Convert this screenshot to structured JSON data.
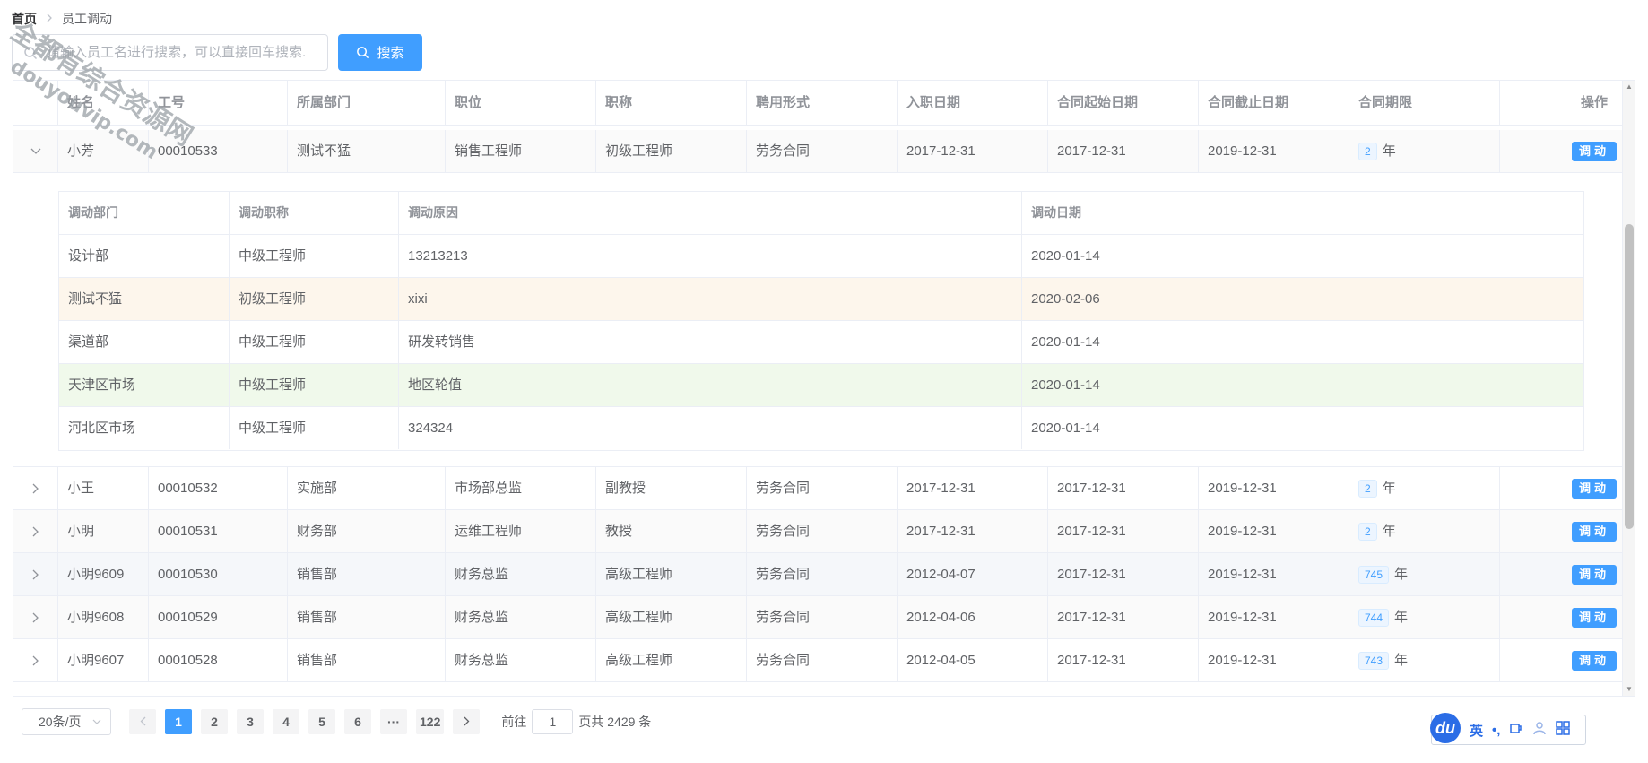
{
  "breadcrumb": {
    "home": "首页",
    "separator": ">",
    "current": "员工调动"
  },
  "search": {
    "placeholder": "请输入员工名进行搜索，可以直接回车搜索...",
    "button_label": "搜索"
  },
  "table": {
    "columns": [
      "",
      "姓名",
      "工号",
      "所属部门",
      "职位",
      "职称",
      "聘用形式",
      "入职日期",
      "合同起始日期",
      "合同截止日期",
      "合同期限",
      "操作"
    ],
    "action_label": "调动",
    "term_unit": "年",
    "rows": [
      {
        "name": "小芳",
        "id": "00010533",
        "dept": "测试不猛",
        "position": "销售工程师",
        "title": "初级工程师",
        "hire": "劳务合同",
        "entry": "2017-12-31",
        "start": "2017-12-31",
        "end": "2019-12-31",
        "term": "2",
        "expanded": true
      },
      {
        "name": "小王",
        "id": "00010532",
        "dept": "实施部",
        "position": "市场部总监",
        "title": "副教授",
        "hire": "劳务合同",
        "entry": "2017-12-31",
        "start": "2017-12-31",
        "end": "2019-12-31",
        "term": "2"
      },
      {
        "name": "小明",
        "id": "00010531",
        "dept": "财务部",
        "position": "运维工程师",
        "title": "教授",
        "hire": "劳务合同",
        "entry": "2017-12-31",
        "start": "2017-12-31",
        "end": "2019-12-31",
        "term": "2"
      },
      {
        "name": "小明9609",
        "id": "00010530",
        "dept": "销售部",
        "position": "财务总监",
        "title": "高级工程师",
        "hire": "劳务合同",
        "entry": "2012-04-07",
        "start": "2017-12-31",
        "end": "2019-12-31",
        "term": "745"
      },
      {
        "name": "小明9608",
        "id": "00010529",
        "dept": "销售部",
        "position": "财务总监",
        "title": "高级工程师",
        "hire": "劳务合同",
        "entry": "2012-04-06",
        "start": "2017-12-31",
        "end": "2019-12-31",
        "term": "744"
      },
      {
        "name": "小明9607",
        "id": "00010528",
        "dept": "销售部",
        "position": "财务总监",
        "title": "高级工程师",
        "hire": "劳务合同",
        "entry": "2012-04-05",
        "start": "2017-12-31",
        "end": "2019-12-31",
        "term": "743"
      }
    ]
  },
  "transfer": {
    "columns": [
      "调动部门",
      "调动职称",
      "调动原因",
      "调动日期"
    ],
    "rows": [
      {
        "dept": "设计部",
        "title": "中级工程师",
        "reason": "13213213",
        "date": "2020-01-14",
        "status": ""
      },
      {
        "dept": "测试不猛",
        "title": "初级工程师",
        "reason": "xixi",
        "date": "2020-02-06",
        "status": "warning"
      },
      {
        "dept": "渠道部",
        "title": "中级工程师",
        "reason": "研发转销售",
        "date": "2020-01-14",
        "status": ""
      },
      {
        "dept": "天津区市场",
        "title": "中级工程师",
        "reason": "地区轮值",
        "date": "2020-01-14",
        "status": "success"
      },
      {
        "dept": "河北区市场",
        "title": "中级工程师",
        "reason": "324324",
        "date": "2020-01-14",
        "status": ""
      }
    ]
  },
  "pagination": {
    "page_size": "20条/页",
    "pages": [
      "1",
      "2",
      "3",
      "4",
      "5",
      "6",
      "···",
      "122"
    ],
    "current": "1",
    "goto_prefix": "前往",
    "goto_value": "1",
    "total_text": "页共 2429 条"
  },
  "ime": {
    "logo": "du",
    "lang": "英",
    "punct": "•,",
    "icons": [
      "cup-icon",
      "user-icon",
      "grid-icon"
    ]
  },
  "watermark": {
    "line1": "全都有综合资源网",
    "line2": "douyouvip.com"
  },
  "colors": {
    "primary": "#409eff",
    "warning_row": "#fdf6ec",
    "success_row": "#f0f9eb"
  }
}
